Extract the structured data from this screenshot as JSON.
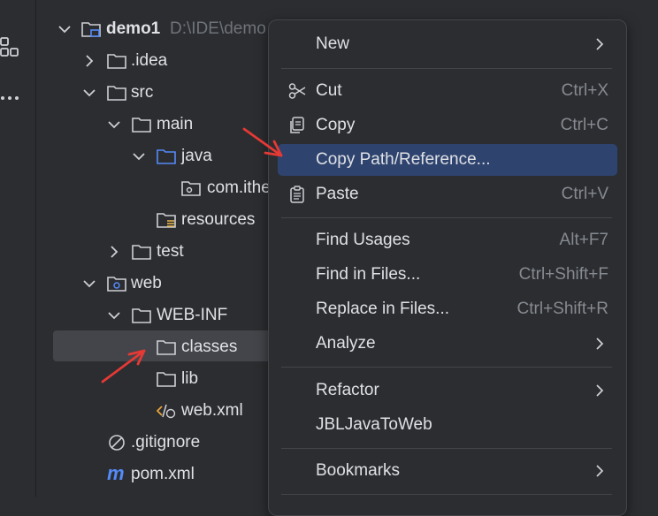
{
  "tree": {
    "project": {
      "name": "demo1",
      "path": "D:\\IDE\\demo"
    },
    "items": [
      {
        "label": ".idea"
      },
      {
        "label": "src"
      },
      {
        "label": "main"
      },
      {
        "label": "java"
      },
      {
        "label": "com.ithe"
      },
      {
        "label": "resources"
      },
      {
        "label": "test"
      },
      {
        "label": "web"
      },
      {
        "label": "WEB-INF"
      },
      {
        "label": "classes"
      },
      {
        "label": "lib"
      },
      {
        "label": "web.xml"
      },
      {
        "label": ".gitignore"
      },
      {
        "label": "pom.xml"
      }
    ]
  },
  "context_menu": {
    "new": "New",
    "cut": "Cut",
    "cut_shortcut": "Ctrl+X",
    "copy": "Copy",
    "copy_shortcut": "Ctrl+C",
    "copy_path": "Copy Path/Reference...",
    "paste": "Paste",
    "paste_shortcut": "Ctrl+V",
    "find_usages": "Find Usages",
    "find_usages_shortcut": "Alt+F7",
    "find_in_files": "Find in Files...",
    "find_in_files_shortcut": "Ctrl+Shift+F",
    "replace_in_files": "Replace in Files...",
    "replace_in_files_shortcut": "Ctrl+Shift+R",
    "analyze": "Analyze",
    "refactor": "Refactor",
    "jbl": "JBLJavaToWeb",
    "bookmarks": "Bookmarks"
  },
  "colors": {
    "background": "#2b2d30",
    "selection": "#43454a",
    "menu_active": "#2e436e",
    "annotation_arrow": "#e53935",
    "folder_blue": "#548af7"
  }
}
